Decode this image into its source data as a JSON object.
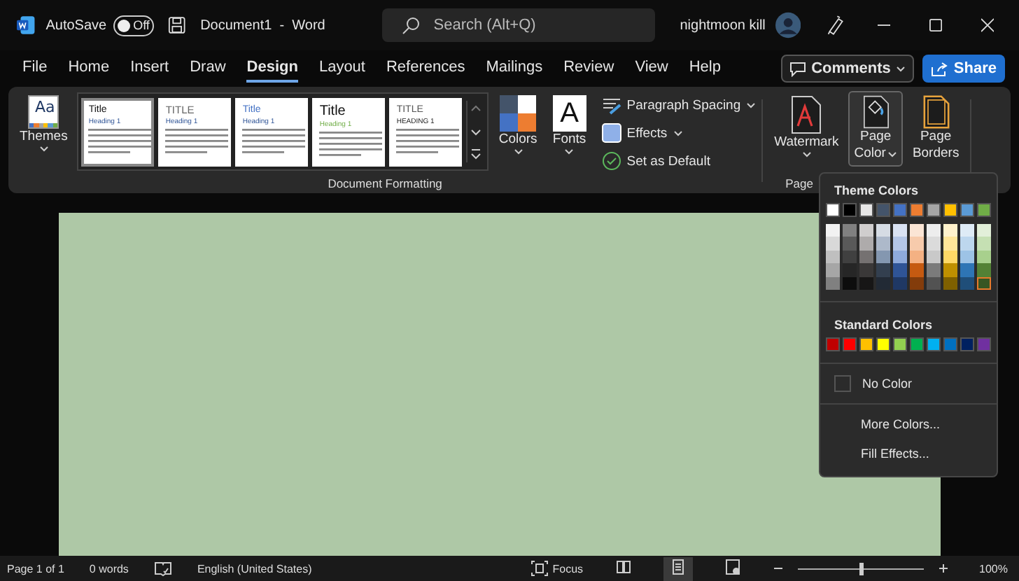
{
  "title_bar": {
    "autosave_label": "AutoSave",
    "autosave_on": false,
    "autosave_state": "Off",
    "document_title": "Document1  -  Word",
    "search": {
      "placeholder": "Search (Alt+Q)"
    },
    "user_name": "nightmoon kill"
  },
  "tabs": [
    {
      "label": "File",
      "selected": false
    },
    {
      "label": "Home",
      "selected": false
    },
    {
      "label": "Insert",
      "selected": false
    },
    {
      "label": "Draw",
      "selected": false
    },
    {
      "label": "Design",
      "selected": true
    },
    {
      "label": "Layout",
      "selected": false
    },
    {
      "label": "References",
      "selected": false
    },
    {
      "label": "Mailings",
      "selected": false
    },
    {
      "label": "Review",
      "selected": false
    },
    {
      "label": "View",
      "selected": false
    },
    {
      "label": "Help",
      "selected": false
    }
  ],
  "comments_button": "Comments",
  "share_button": "Share",
  "ribbon": {
    "themes": {
      "glyph": "Aa",
      "label": "Themes"
    },
    "style_gallery": [
      {
        "kind": "basic",
        "title": "Title",
        "heading": "Heading 1",
        "selected": true
      },
      {
        "kind": "caps",
        "title": "TITLE",
        "heading": "Heading 1",
        "selected": false
      },
      {
        "kind": "blue",
        "title": "Title",
        "heading": "Heading 1",
        "selected": false
      },
      {
        "kind": "large",
        "title": "Title",
        "heading": "Heading 1",
        "selected": false
      },
      {
        "kind": "shaded",
        "title": "TITLE",
        "heading": "HEADING 1",
        "selected": false
      }
    ],
    "colors_label": "Colors",
    "fonts": {
      "glyph": "A",
      "label": "Fonts"
    },
    "paragraph_spacing": "Paragraph Spacing",
    "effects": "Effects",
    "set_as_default": "Set as Default",
    "group_document_formatting": "Document Formatting",
    "watermark": "Watermark",
    "page_color": [
      "Page",
      "Color"
    ],
    "page_borders": [
      "Page",
      "Borders"
    ],
    "group_page": "Page"
  },
  "color_menu": {
    "theme_heading": "Theme Colors",
    "theme_colors": [
      {
        "color": "#ffffff",
        "shades": [
          {
            "color": "#f2f2f2",
            "selected": false
          },
          {
            "color": "#d9d9d9",
            "selected": false
          },
          {
            "color": "#bfbfbf",
            "selected": false
          },
          {
            "color": "#a6a6a6",
            "selected": false
          },
          {
            "color": "#808080",
            "selected": false
          }
        ]
      },
      {
        "color": "#000000",
        "shades": [
          {
            "color": "#808080",
            "selected": false
          },
          {
            "color": "#595959",
            "selected": false
          },
          {
            "color": "#404040",
            "selected": false
          },
          {
            "color": "#262626",
            "selected": false
          },
          {
            "color": "#0d0d0d",
            "selected": false
          }
        ]
      },
      {
        "color": "#e7e6e6",
        "shades": [
          {
            "color": "#d0cece",
            "selected": false
          },
          {
            "color": "#aeabab",
            "selected": false
          },
          {
            "color": "#757171",
            "selected": false
          },
          {
            "color": "#3a3838",
            "selected": false
          },
          {
            "color": "#171616",
            "selected": false
          }
        ]
      },
      {
        "color": "#44546a",
        "shades": [
          {
            "color": "#d6dce4",
            "selected": false
          },
          {
            "color": "#adb9ca",
            "selected": false
          },
          {
            "color": "#8497b0",
            "selected": false
          },
          {
            "color": "#333f4f",
            "selected": false
          },
          {
            "color": "#222a35",
            "selected": false
          }
        ]
      },
      {
        "color": "#4472c4",
        "shades": [
          {
            "color": "#d9e2f3",
            "selected": false
          },
          {
            "color": "#b4c6e7",
            "selected": false
          },
          {
            "color": "#8eaadb",
            "selected": false
          },
          {
            "color": "#2f5496",
            "selected": false
          },
          {
            "color": "#1f3864",
            "selected": false
          }
        ]
      },
      {
        "color": "#ed7d31",
        "shades": [
          {
            "color": "#fbe5d5",
            "selected": false
          },
          {
            "color": "#f7cbac",
            "selected": false
          },
          {
            "color": "#f4b183",
            "selected": false
          },
          {
            "color": "#c55a11",
            "selected": false
          },
          {
            "color": "#833c0b",
            "selected": false
          }
        ]
      },
      {
        "color": "#a5a5a5",
        "shades": [
          {
            "color": "#ededed",
            "selected": false
          },
          {
            "color": "#dbdbdb",
            "selected": false
          },
          {
            "color": "#c9c9c9",
            "selected": false
          },
          {
            "color": "#7b7b7b",
            "selected": false
          },
          {
            "color": "#525252",
            "selected": false
          }
        ]
      },
      {
        "color": "#ffc000",
        "shades": [
          {
            "color": "#fff2cc",
            "selected": false
          },
          {
            "color": "#ffe699",
            "selected": false
          },
          {
            "color": "#ffd966",
            "selected": false
          },
          {
            "color": "#bf9000",
            "selected": false
          },
          {
            "color": "#7f6000",
            "selected": false
          }
        ]
      },
      {
        "color": "#5b9bd5",
        "shades": [
          {
            "color": "#deebf6",
            "selected": false
          },
          {
            "color": "#bdd7ee",
            "selected": false
          },
          {
            "color": "#9dc3e6",
            "selected": false
          },
          {
            "color": "#2e75b5",
            "selected": false
          },
          {
            "color": "#1f4e79",
            "selected": false
          }
        ]
      },
      {
        "color": "#70ad47",
        "shades": [
          {
            "color": "#e2efd9",
            "selected": false
          },
          {
            "color": "#c5e0b3",
            "selected": false
          },
          {
            "color": "#a8d08d",
            "selected": false
          },
          {
            "color": "#538135",
            "selected": false
          },
          {
            "color": "#375623",
            "selected": true
          }
        ]
      }
    ],
    "standard_heading": "Standard Colors",
    "standard_colors": [
      {
        "color": "#c00000"
      },
      {
        "color": "#ff0000"
      },
      {
        "color": "#ffc000"
      },
      {
        "color": "#ffff00"
      },
      {
        "color": "#92d050"
      },
      {
        "color": "#00b050"
      },
      {
        "color": "#00b0f0"
      },
      {
        "color": "#0070c0"
      },
      {
        "color": "#002060"
      },
      {
        "color": "#7030a0"
      }
    ],
    "no_color": "No Color",
    "more_colors": "More Colors...",
    "fill_effects": "Fill Effects..."
  },
  "status_bar": {
    "page": "Page 1 of 1",
    "words": "0 words",
    "language": "English (United States)",
    "focus": "Focus",
    "views": [
      {
        "kind": "read",
        "selected": false
      },
      {
        "kind": "print",
        "selected": true
      },
      {
        "kind": "web",
        "selected": false
      }
    ],
    "zoom": {
      "level": 0.5,
      "reading": "100%"
    }
  }
}
